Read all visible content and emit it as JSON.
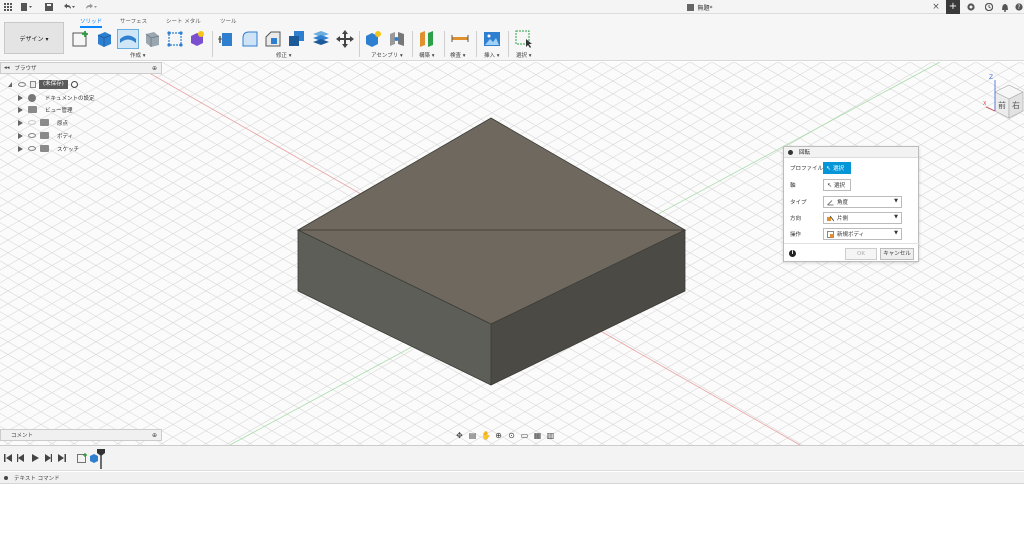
{
  "title_bar": {
    "document_title": "無題*",
    "close_glyph": "×",
    "new_tab_glyph": "+"
  },
  "toolbar": {
    "workspace_label": "デザイン ▾",
    "tabs": [
      {
        "label": "ソリッド",
        "active": true
      },
      {
        "label": "サーフェス",
        "active": false
      },
      {
        "label": "シート メタル",
        "active": false
      },
      {
        "label": "ツール",
        "active": false
      }
    ],
    "groups": {
      "create": "作成 ▾",
      "modify": "修正 ▾",
      "assemble": "アセンブリ ▾",
      "construct": "構築 ▾",
      "inspect": "検査 ▾",
      "insert": "挿入 ▾",
      "select": "選択 ▾"
    }
  },
  "browser": {
    "header": "ブラウザ",
    "root_label": "(未保存)",
    "items": [
      {
        "label": "ドキュメントの設定"
      },
      {
        "label": "ビュー管理"
      },
      {
        "label": "原点"
      },
      {
        "label": "ボディ"
      },
      {
        "label": "スケッチ"
      }
    ]
  },
  "comments": {
    "label": "コメント"
  },
  "dialog": {
    "title": "回転",
    "rows": {
      "profile_label": "プロファイル",
      "profile_value": "選択",
      "axis_label": "軸",
      "axis_value": "選択",
      "type_label": "タイプ",
      "type_value": "角度",
      "direction_label": "方向",
      "direction_value": "片側",
      "operation_label": "操作",
      "operation_value": "新規ボディ"
    },
    "ok_label": "OK",
    "cancel_label": "キャンセル",
    "info_glyph": "i"
  },
  "viewcube": {
    "face_front": "前",
    "face_right": "右",
    "axis_z": "Z",
    "axis_x": "X"
  },
  "text_commands": {
    "label": "テキスト コマンド"
  },
  "colors": {
    "accent": "#0696d7",
    "tab_active": "#0a84ff",
    "box_top": "#6e685e",
    "box_left": "#5e5e58",
    "box_right": "#4c4a44"
  }
}
